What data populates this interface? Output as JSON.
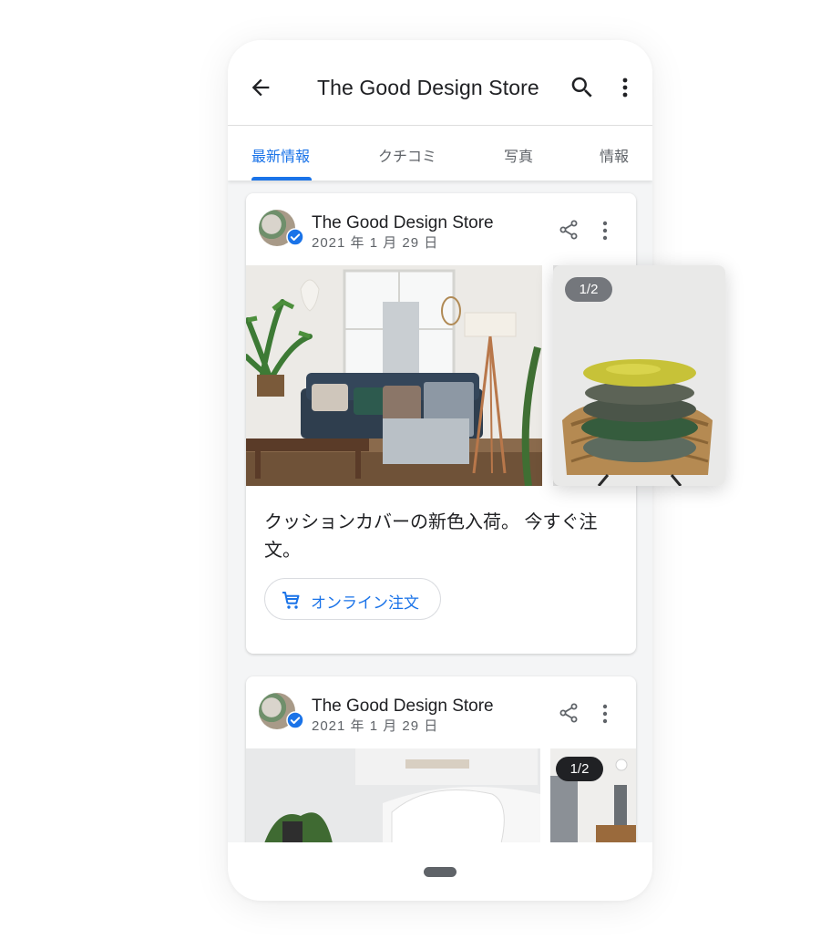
{
  "app_bar": {
    "title": "The Good Design Store",
    "back_icon": "arrow-back-icon",
    "search_icon": "search-icon",
    "more_icon": "more-vert-icon"
  },
  "tabs": [
    {
      "label": "最新情報",
      "active": true
    },
    {
      "label": "クチコミ",
      "active": false
    },
    {
      "label": "写真",
      "active": false
    },
    {
      "label": "情報",
      "active": false
    }
  ],
  "posts": [
    {
      "store_name": "The Good Design Store",
      "date": "2021 年 1 月 29 日",
      "text": "クッションカバーの新色入荷。 今すぐ注文。",
      "cta_label": "オンライン注文",
      "photo_counter": "1/2"
    },
    {
      "store_name": "The Good Design Store",
      "date": "2021 年 1 月 29 日",
      "photo_counter": "1/2"
    }
  ],
  "colors": {
    "accent": "#1a73e8",
    "text_primary": "#202124",
    "text_secondary": "#5f6368"
  }
}
